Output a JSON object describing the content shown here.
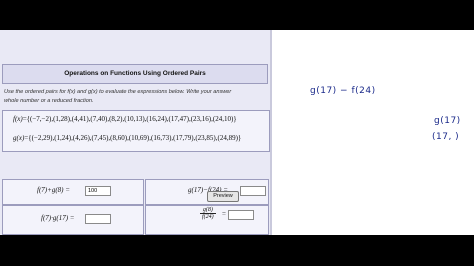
{
  "problem": {
    "title": "Operations on Functions Using Ordered Pairs",
    "instruction_line1": "Use the ordered pairs for f(x) and g(x) to evaluate the expressions below. Write your answer",
    "instruction_line2": "whole number or a reduced fraction.",
    "f_label": "f(x)",
    "f_pairs": "={(−7,−2),(1,28),(4,41),(7,40),(8,2),(10,13),(16,24),(17,47),(23,16),(24,10)}",
    "g_label": "g(x)",
    "g_pairs": "={(−2,29),(1,24),(4,26),(7,45),(8,60),(10,69),(16,73),(17,79),(23,85),(24,89)}",
    "q1_expr": "f(7)+g(8) =",
    "q1_value": "100",
    "q2_expr": "g(17)−f(24) =",
    "q2_value": "",
    "q3_expr": "f(7)·g(17) =",
    "q3_value": "",
    "q4_num": "g(8)",
    "q4_den": "f(24)",
    "q4_eq": "=",
    "q4_value": "",
    "preview_label": "Preview"
  },
  "notes": {
    "line1": "g(17) − f(24)",
    "line2": "g(17)",
    "line3": "(17, )"
  }
}
